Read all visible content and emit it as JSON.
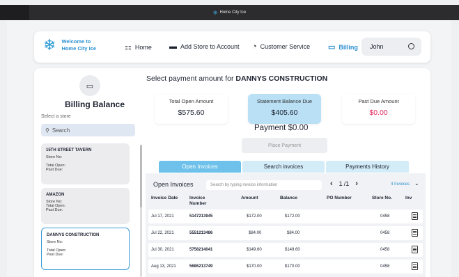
{
  "window": {
    "title": "Home City Ice"
  },
  "header": {
    "welcome_line1": "Welcome to",
    "welcome_line2": "Home City Ice",
    "nav": {
      "home": "Home",
      "add_store": "Add Store to Account",
      "customer_service": "Customer Service",
      "billing": "Billing"
    },
    "user": "John"
  },
  "sidebar": {
    "title": "Billing Balance",
    "select_label": "Select a store",
    "search_placeholder": "Search",
    "stores": [
      {
        "name": "15TH STREET TAVERN",
        "store_no": "Store No:",
        "total_open": "Total Open:",
        "past_due": "Past Due:"
      },
      {
        "name": "AMAZON",
        "store_no": "Store No:",
        "total_open": "Total Open:",
        "past_due": "Past Due:"
      },
      {
        "name": "DANNYS CONSTRUCTION",
        "store_no": "Store No:",
        "total_open": "Total Open:",
        "past_due": "Past Due:"
      }
    ]
  },
  "main": {
    "heading_prefix": "Select payment amount for",
    "heading_store": "DANNYS CONSTRUCTION",
    "stats": [
      {
        "label": "Total Open Amount",
        "value": "$575.60"
      },
      {
        "label": "Statement Balance Due",
        "value": "$405.60"
      },
      {
        "label": "Past Due Amount",
        "value": "$0.00"
      }
    ],
    "payment_label": "Payment",
    "payment_value": "$0.00",
    "place_payment": "Place Payment",
    "tabs": [
      "Open Invoices",
      "Search invoices",
      "Payments History"
    ],
    "table": {
      "title": "Open Invoices",
      "search_placeholder": "Search by typing invoice information",
      "page_current": "1",
      "page_total": "/1",
      "count": "4 Invoices",
      "columns": [
        "Invoice Date",
        "Invoice Number",
        "Amount",
        "Balance",
        "PO Number",
        "Store No.",
        "Inv"
      ],
      "rows": [
        {
          "date": "Jul 17, 2021",
          "number": "5147213945",
          "amount": "$172.00",
          "balance": "$172.00",
          "po": "",
          "store": "0458"
        },
        {
          "date": "Jul 22, 2021",
          "number": "5551213486",
          "amount": "$84.00",
          "balance": "$84.00",
          "po": "",
          "store": "0458"
        },
        {
          "date": "Jul 30, 2021",
          "number": "5758214041",
          "amount": "$149.60",
          "balance": "$149.60",
          "po": "",
          "store": "0458"
        },
        {
          "date": "Aug 13, 2021",
          "number": "5686213749",
          "amount": "$170.00",
          "balance": "$170.00",
          "po": "",
          "store": "0458"
        }
      ]
    }
  },
  "colors": {
    "accent": "#2b8fd0",
    "tab_active": "#6dc1ea",
    "highlight": "#b9e0f5",
    "past_due": "#e0285a"
  }
}
